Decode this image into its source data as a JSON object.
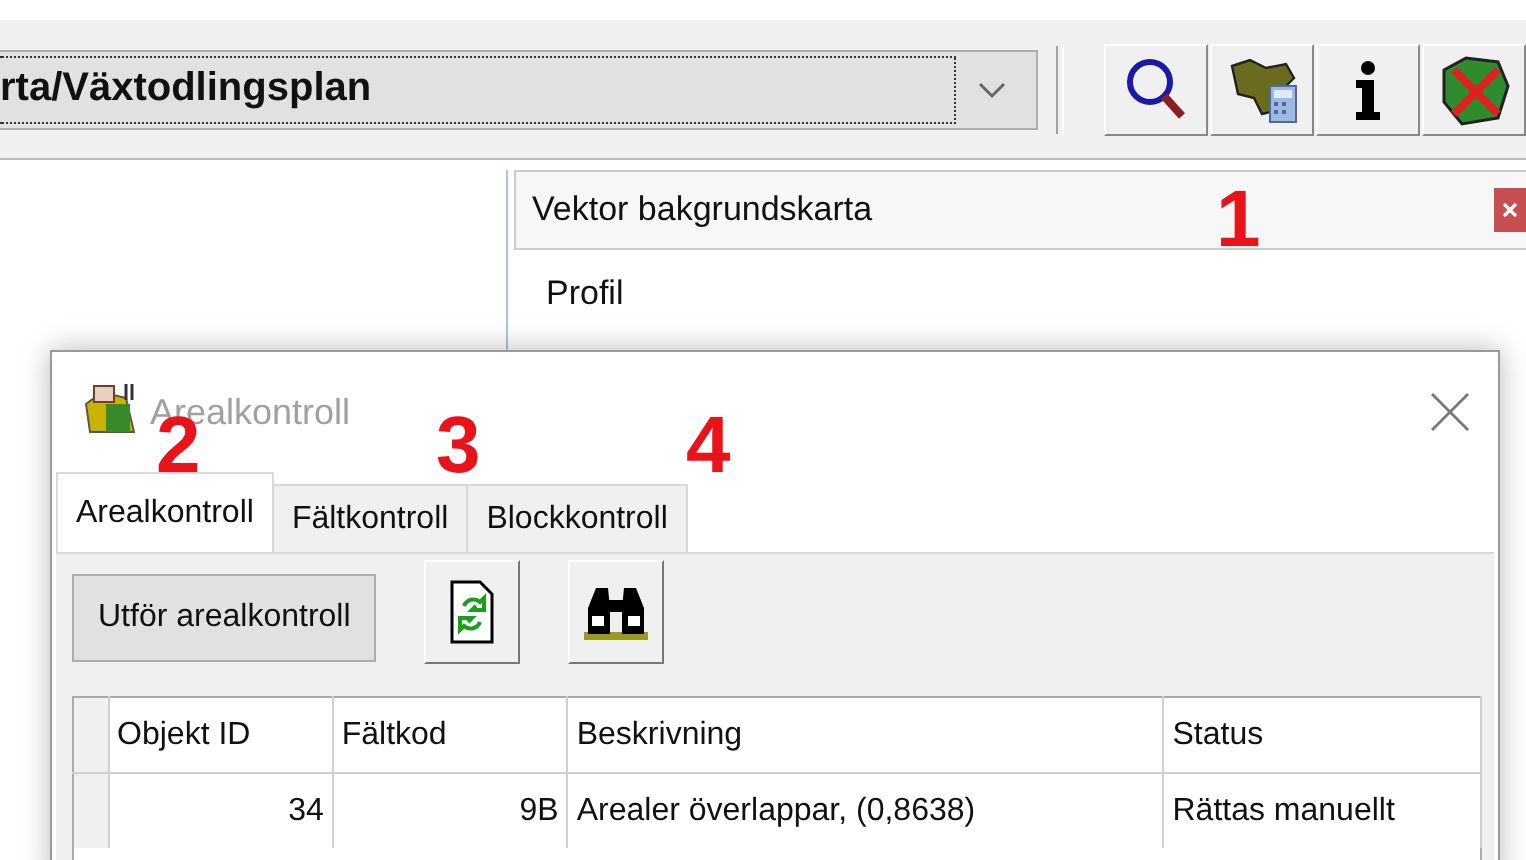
{
  "toolbar": {
    "path": "rta/Växtodlingsplan"
  },
  "panel": {
    "title": "Vektor bakgrundskarta",
    "items": [
      "Profil"
    ]
  },
  "dialog": {
    "title": "Arealkontroll",
    "tabs": [
      {
        "label": "Arealkontroll",
        "selected": true
      },
      {
        "label": "Fältkontroll",
        "selected": false
      },
      {
        "label": "Blockkontroll",
        "selected": false
      }
    ],
    "run_button": "Utför arealkontroll",
    "table": {
      "columns": [
        "Objekt ID",
        "Fältkod",
        "Beskrivning",
        "Status"
      ],
      "rows": [
        [
          "34",
          "9B",
          "Arealer överlappar, (0,8638)",
          "Rättas manuellt"
        ]
      ]
    }
  },
  "annotations": [
    "1",
    "2",
    "3",
    "4"
  ]
}
